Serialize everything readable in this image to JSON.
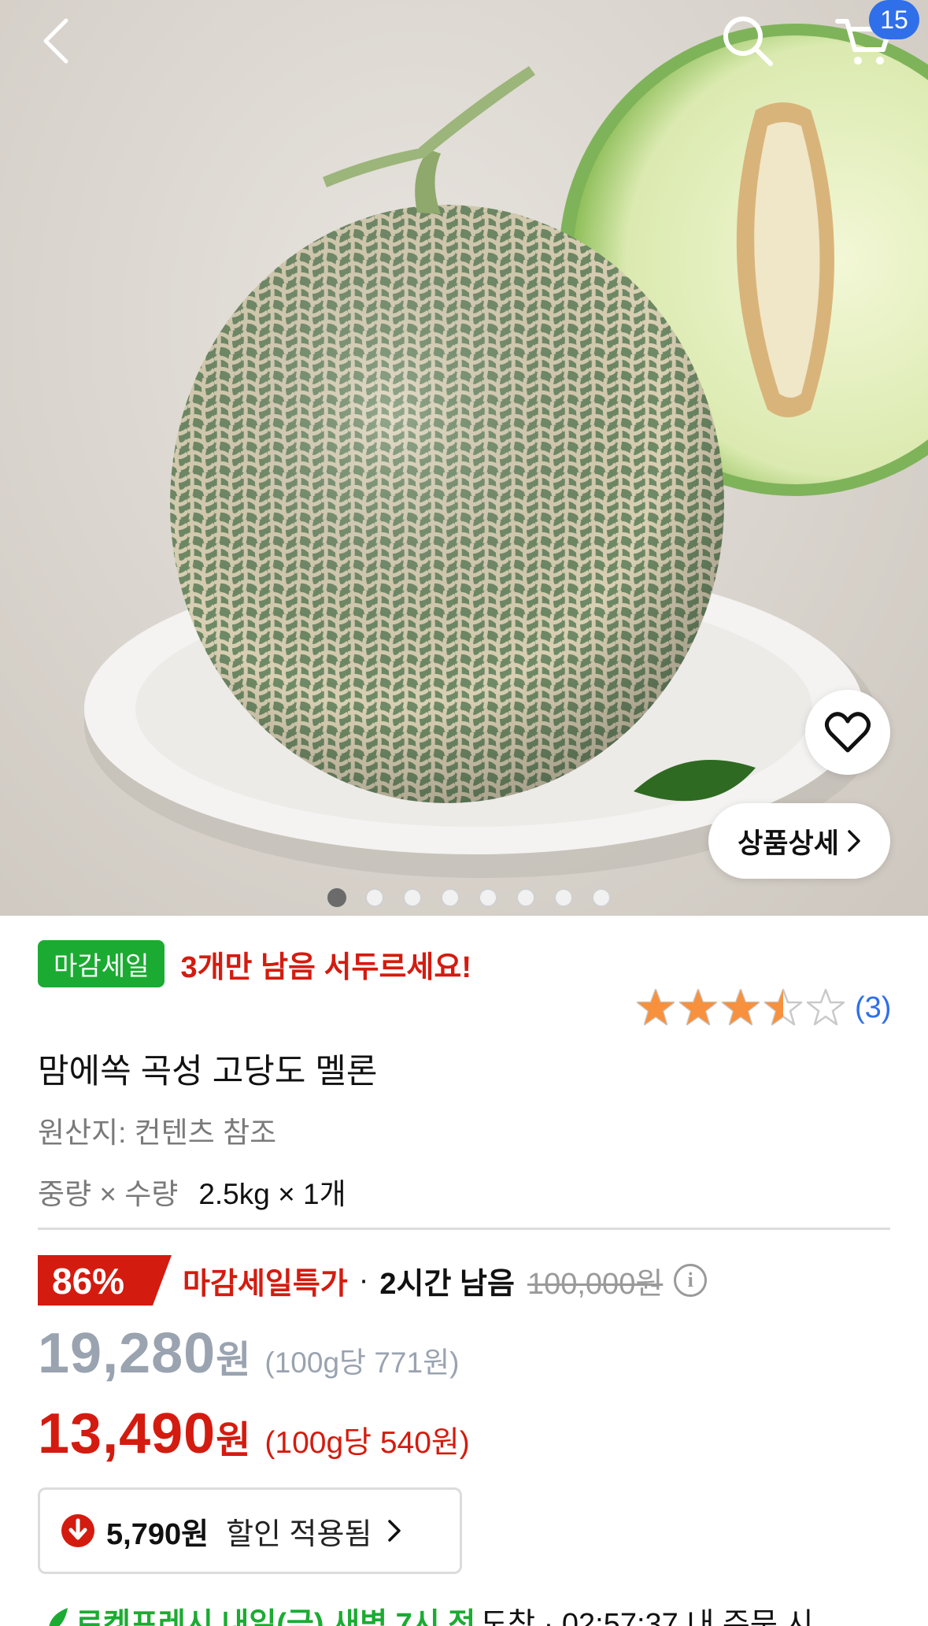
{
  "header": {
    "back_icon": "chevron-left-icon",
    "search_icon": "search-icon",
    "cart_icon": "cart-icon",
    "cart_count": "15"
  },
  "gallery": {
    "image_count": 8,
    "active_index": 0,
    "wishlist_icon": "heart-outline-icon",
    "detail_button_label": "상품상세"
  },
  "product": {
    "sale_badge": "마감세일",
    "stock_notice": "3개만 남음 서두르세요!",
    "rating_value": 3.5,
    "rating_max": 5,
    "review_count": "(3)",
    "title": "맘에쏙 곡성 고당도 멜론",
    "origin": "원산지: 컨텐츠 참조",
    "weight_label": "중량 × 수량",
    "weight_value": "2.5kg × 1개"
  },
  "pricing": {
    "discount_pct": "86%",
    "promo_label": "마감세일특가",
    "separator": "·",
    "time_left": "2시간 남음",
    "original_price": "100,000원",
    "sale_price": "19,280",
    "sale_price_won": "원",
    "sale_unit_price": "(100g당 771원)",
    "final_price": "13,490",
    "final_price_won": "원",
    "final_unit_price": "(100g당 540원)",
    "coupon_amount": "5,790원",
    "coupon_text": "할인 적용됨"
  },
  "delivery": {
    "bold_text": "로켓프레시 내일(금) 새벽 7시 전",
    "rest_text": "도착 · 02:57:37 내 주문 시"
  },
  "colors": {
    "accent_red": "#d41b0f",
    "sale_green": "#1bab32",
    "link_blue": "#2f6fea",
    "star_orange": "#f7913d"
  }
}
